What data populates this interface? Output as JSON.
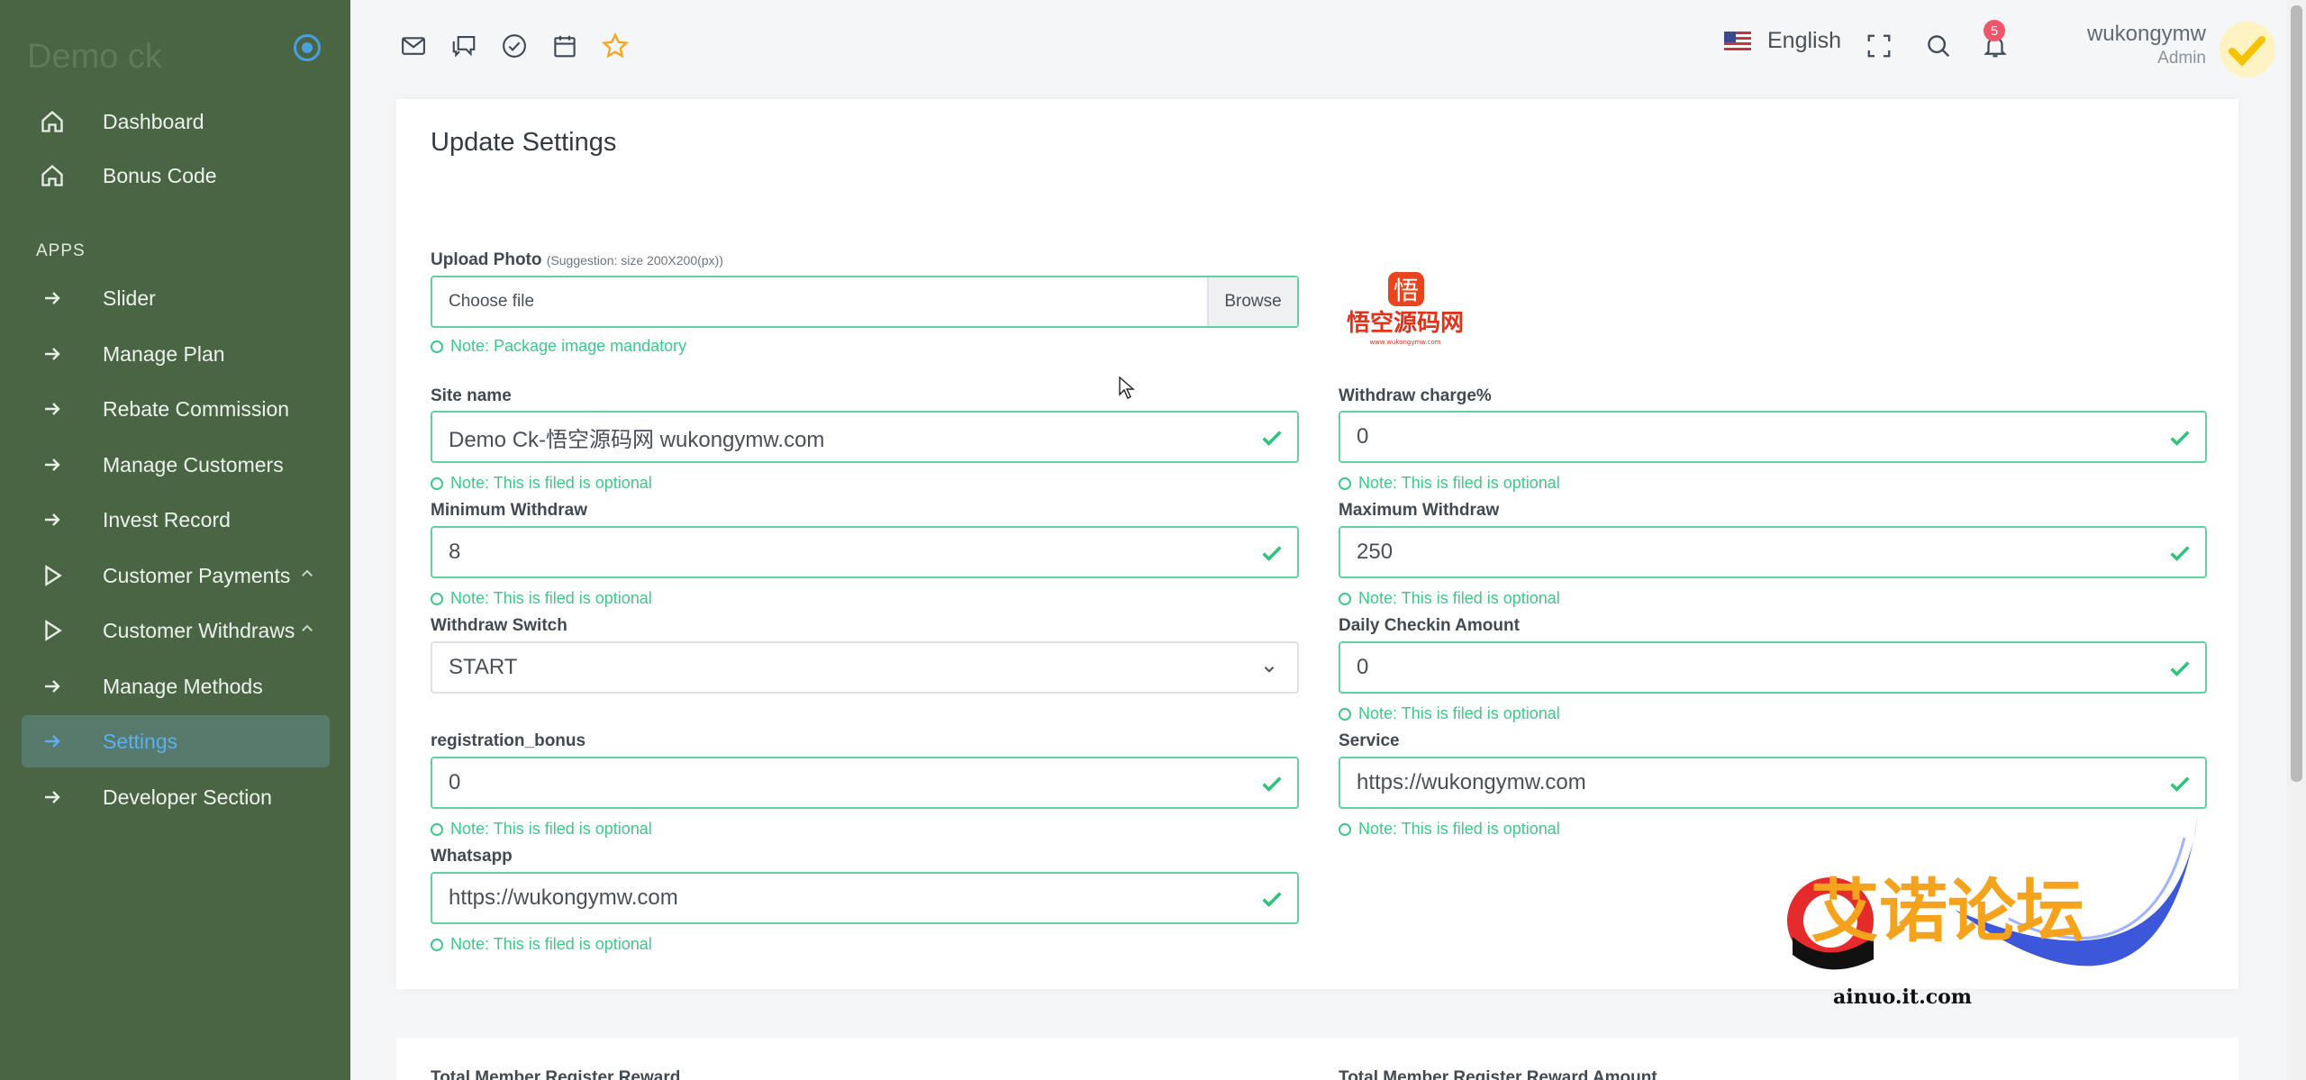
{
  "app": {
    "brand": "Demo ck"
  },
  "sidebar": {
    "section_label": "APPS",
    "items": [
      {
        "label": "Dashboard",
        "icon": "home-icon"
      },
      {
        "label": "Bonus Code",
        "icon": "home-icon"
      },
      {
        "label": "Slider",
        "icon": "arrow-right-icon"
      },
      {
        "label": "Manage Plan",
        "icon": "arrow-right-icon"
      },
      {
        "label": "Rebate Commission",
        "icon": "arrow-right-icon"
      },
      {
        "label": "Manage Customers",
        "icon": "arrow-right-icon"
      },
      {
        "label": "Invest Record",
        "icon": "arrow-right-icon"
      },
      {
        "label": "Customer Payments",
        "icon": "play-icon"
      },
      {
        "label": "Customer Withdraws",
        "icon": "play-icon"
      },
      {
        "label": "Manage Methods",
        "icon": "arrow-right-icon"
      },
      {
        "label": "Settings",
        "icon": "arrow-right-icon",
        "active": true
      },
      {
        "label": "Developer Section",
        "icon": "arrow-right-icon"
      }
    ]
  },
  "topbar": {
    "icons": [
      "mail-icon",
      "chat-icon",
      "check-circle-icon",
      "calendar-icon",
      "star-icon"
    ],
    "language": "English",
    "notification_count": "5",
    "user_name": "wukongymw",
    "user_role": "Admin"
  },
  "form": {
    "title": "Update Settings",
    "upload_label": "Upload Photo",
    "upload_hint": "(Suggestion: size 200X200(px))",
    "file_placeholder": "Choose file",
    "browse_label": "Browse",
    "upload_note": "Note: Package image mandatory",
    "logo_text": "悟空源码网",
    "logo_char": "悟",
    "logo_url": "www.wukongymw.com",
    "optional_note": "Note: This is filed is optional",
    "site_name_label": "Site name",
    "site_name_value": "Demo Ck-悟空源码网 wukongymw.com",
    "withdraw_charge_label": "Withdraw charge%",
    "withdraw_charge_value": "0",
    "min_withdraw_label": "Minimum Withdraw",
    "min_withdraw_value": "8",
    "max_withdraw_label": "Maximum Withdraw",
    "max_withdraw_value": "250",
    "withdraw_switch_label": "Withdraw Switch",
    "withdraw_switch_value": "START",
    "daily_checkin_label": "Daily Checkin Amount",
    "daily_checkin_value": "0",
    "reg_bonus_label": "registration_bonus",
    "reg_bonus_value": "0",
    "service_label": "Service",
    "service_value": "https://wukongymw.com",
    "whatsapp_label": "Whatsapp",
    "whatsapp_value": "https://wukongymw.com",
    "next_label_left": "Total Member Register Reward",
    "next_label_right": "Total Member Register Reward Amount"
  },
  "watermark": {
    "text": "艾诺论坛",
    "url": "ainuo.it.com"
  },
  "colors": {
    "sidebar": "#4a6544",
    "active_bg": "#577a6d",
    "accent": "#5ab0f0",
    "success": "#3cc98a",
    "badge": "#f1556c",
    "star": "#f6a623"
  }
}
